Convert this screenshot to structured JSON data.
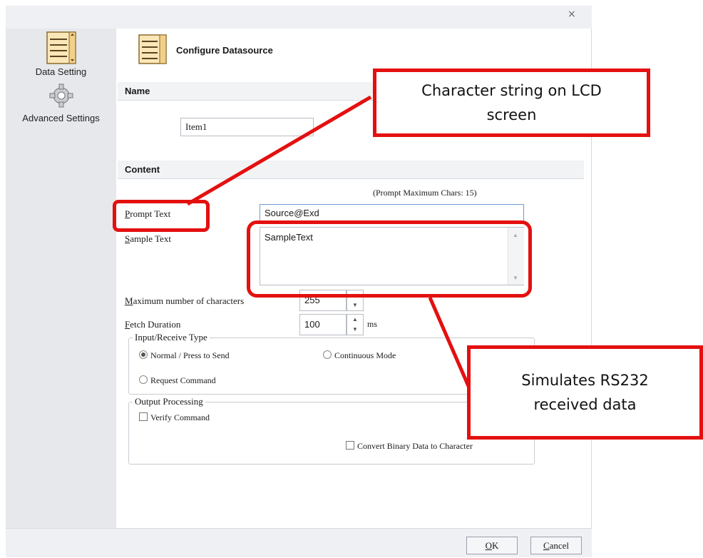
{
  "window": {
    "close_glyph": "×"
  },
  "sidebar": {
    "items": [
      {
        "label": "Data Setting",
        "icon": "datasource-list-icon"
      },
      {
        "label": "Advanced Settings",
        "icon": "gear-icon"
      }
    ]
  },
  "header": {
    "title": "Configure Datasource"
  },
  "name_section": {
    "title": "Name",
    "value": "Item1"
  },
  "content_section": {
    "title": "Content",
    "prompt_hint": "(Prompt Maximum Chars: 15)",
    "prompt_label_first": "P",
    "prompt_label_rest": "rompt Text",
    "prompt_value": "Source@Exd",
    "sample_label_first": "S",
    "sample_label_rest": "ample Text",
    "sample_value": "SampleText",
    "max_label_first": "M",
    "max_label_rest": "aximum number of characters",
    "max_value": "255",
    "fetch_label_first": "F",
    "fetch_label_rest": "etch Duration",
    "fetch_value": "100",
    "fetch_unit": "ms"
  },
  "input_receive": {
    "title": "Input/Receive Type",
    "options": [
      {
        "label": "Normal / Press to Send",
        "selected": true
      },
      {
        "label": "Continuous Mode",
        "selected": false
      },
      {
        "label": "Request Command",
        "selected": false
      }
    ]
  },
  "output_processing": {
    "title": "Output Processing",
    "verify_label": "Verify Command",
    "verify_checked": false,
    "convert_label": "Convert Binary Data to Character",
    "convert_checked": false
  },
  "footer": {
    "ok_first": "O",
    "ok_rest": "K",
    "cancel_first": "C",
    "cancel_rest": "ancel"
  },
  "annotations": {
    "lcd_callout": "Character string on LCD screen",
    "rs232_callout": "Simulates RS232 received data",
    "highlight_color": "#e41010"
  }
}
